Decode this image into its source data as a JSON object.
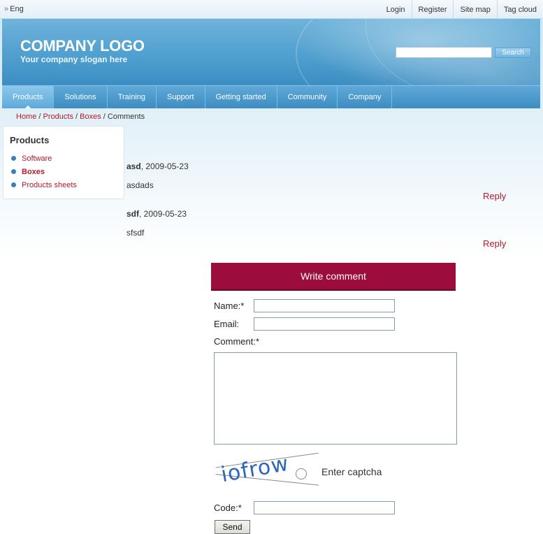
{
  "topbar": {
    "language": "Eng",
    "links": [
      "Login",
      "Register",
      "Site map",
      "Tag cloud"
    ]
  },
  "header": {
    "logo": "COMPANY LOGO",
    "slogan": "Your company slogan here",
    "search_value": "",
    "search_button": "Search"
  },
  "nav": {
    "items": [
      "Products",
      "Solutions",
      "Training",
      "Support",
      "Getting started",
      "Community",
      "Company"
    ],
    "active": "Products"
  },
  "breadcrumb": {
    "links": [
      "Home",
      "Products",
      "Boxes"
    ],
    "current": "Comments",
    "separator": "/"
  },
  "sidebar": {
    "title": "Products",
    "items": [
      {
        "label": "Software",
        "selected": false
      },
      {
        "label": "Boxes",
        "selected": true
      },
      {
        "label": "Products sheets",
        "selected": false
      }
    ]
  },
  "comments": [
    {
      "author": "asd",
      "date": ", 2009-05-23",
      "text": "asdads",
      "reply": "Reply"
    },
    {
      "author": "sdf",
      "date": ", 2009-05-23",
      "text": "sfsdf",
      "reply": "Reply"
    }
  ],
  "form": {
    "title": "Write comment",
    "name_label": "Name:*",
    "name_value": "",
    "email_label": "Email:",
    "email_value": "",
    "comment_label": "Comment:*",
    "comment_value": "",
    "captcha_image_text": "iofrow",
    "captcha_label": "Enter captcha",
    "code_label": "Code:*",
    "code_value": "",
    "send_button": "Send"
  },
  "colors": {
    "accent": "#b01a2c",
    "form_header": "#9c0c3c",
    "header_blue": "#4f9fcf"
  }
}
